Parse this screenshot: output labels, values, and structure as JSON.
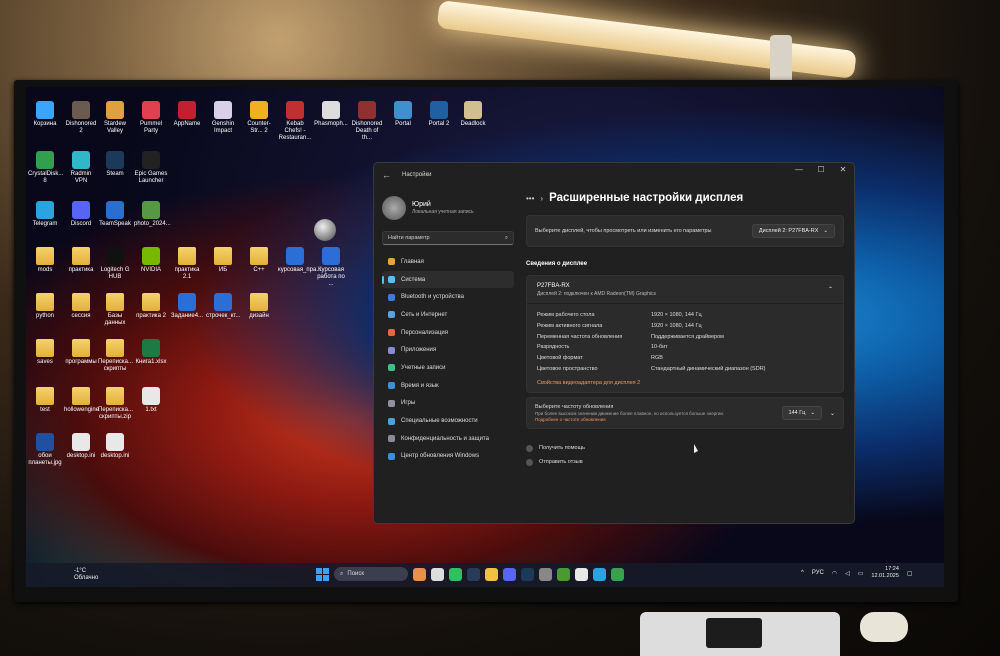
{
  "desktop_icons": [
    {
      "label": "Корзина",
      "x": 0,
      "color": "#3aa4ff"
    },
    {
      "label": "Dishonored 2",
      "color": "#6a5a50"
    },
    {
      "label": "Stardew Valley",
      "color": "#e0a040"
    },
    {
      "label": "Pummel Party",
      "color": "#e04050"
    },
    {
      "label": "AppName",
      "color": "#c02030"
    },
    {
      "label": "Genshin Impact",
      "color": "#d8d0e8"
    },
    {
      "label": "Counter-Str... 2",
      "color": "#f0b020"
    },
    {
      "label": "Kebab Chefs! - Restauran...",
      "color": "#c03030"
    },
    {
      "label": "Phasmoph...",
      "color": "#ddd"
    },
    {
      "label": "Dishonored Death of th...",
      "color": "#903030"
    },
    {
      "label": "Portal",
      "color": "#4090d0"
    },
    {
      "label": "Portal 2",
      "color": "#2060a0"
    },
    {
      "label": "Deadlock",
      "color": "#d0c090"
    },
    {
      "label": "CrystalDisk... 8",
      "color": "#30a050"
    },
    {
      "label": "Radmin VPN",
      "color": "#2fb8c8"
    },
    {
      "label": "Steam",
      "color": "#1b3a5a"
    },
    {
      "label": "Epic Games Launcher",
      "color": "#222"
    },
    {
      "label": "Telegram",
      "color": "#2aa3e0"
    },
    {
      "label": "Discord",
      "color": "#5865f2"
    },
    {
      "label": "TeamSpeak",
      "color": "#2a6fd0"
    },
    {
      "label": "photo_2024...",
      "color": "#559944"
    },
    {
      "label": "mods",
      "type": "folder"
    },
    {
      "label": "практика",
      "type": "folder"
    },
    {
      "label": "Logitech G HUB",
      "color": "#111"
    },
    {
      "label": "NVIDIA",
      "color": "#76b900"
    },
    {
      "label": "практика 2.1",
      "type": "folder"
    },
    {
      "label": "ИБ",
      "type": "folder"
    },
    {
      "label": "C++",
      "type": "folder"
    },
    {
      "label": "курсовая_пра...",
      "type": "doc"
    },
    {
      "label": "Курсовая работа по ...",
      "type": "doc"
    },
    {
      "label": "python",
      "type": "folder"
    },
    {
      "label": "сессия",
      "type": "folder"
    },
    {
      "label": "Базы данных",
      "type": "folder"
    },
    {
      "label": "практика 2",
      "type": "folder"
    },
    {
      "label": "Задание4...",
      "type": "doc"
    },
    {
      "label": "строчек_кт...",
      "type": "doc"
    },
    {
      "label": "дизайн",
      "type": "folder"
    },
    {
      "label": "saves",
      "type": "folder"
    },
    {
      "label": "программы",
      "type": "folder"
    },
    {
      "label": "Переписка... скрипты",
      "type": "folder"
    },
    {
      "label": "Книга1.xlsx",
      "color": "#1d7a44"
    },
    {
      "label": "test",
      "type": "folder"
    },
    {
      "label": "hollowengine",
      "type": "folder"
    },
    {
      "label": "Переписка... скрипты.zip",
      "type": "folder"
    },
    {
      "label": "1.txt",
      "type": "txt"
    },
    {
      "label": "обои планеты.jpg",
      "color": "#2050a0"
    },
    {
      "label": "desktop.ini",
      "type": "txt"
    },
    {
      "label": "desktop.ini",
      "type": "txt"
    }
  ],
  "window": {
    "title": "Настройки",
    "controls": [
      "—",
      "☐",
      "✕"
    ]
  },
  "profile": {
    "name": "Юрий",
    "subtitle": "Локальная учетная запись"
  },
  "search": {
    "placeholder": "Найти параметр",
    "icon": "search-icon"
  },
  "nav": [
    {
      "label": "Главная",
      "icon": "home-icon",
      "color": "#e8a33a"
    },
    {
      "label": "Система",
      "icon": "monitor-icon",
      "color": "#4cc2ff",
      "active": true
    },
    {
      "label": "Bluetooth и устройства",
      "icon": "bluetooth-icon",
      "color": "#3a7be0"
    },
    {
      "label": "Сеть и Интернет",
      "icon": "wifi-icon",
      "color": "#5aa0e0"
    },
    {
      "label": "Персонализация",
      "icon": "brush-icon",
      "color": "#e06a3a"
    },
    {
      "label": "Приложения",
      "icon": "apps-icon",
      "color": "#8a8ad0"
    },
    {
      "label": "Учетные записи",
      "icon": "person-icon",
      "color": "#3ac08a"
    },
    {
      "label": "Время и язык",
      "icon": "globe-icon",
      "color": "#3a90e0"
    },
    {
      "label": "Игры",
      "icon": "gamepad-icon",
      "color": "#9090a0"
    },
    {
      "label": "Специальные возможности",
      "icon": "accessibility-icon",
      "color": "#4aa0e0"
    },
    {
      "label": "Конфиденциальность и защита",
      "icon": "shield-icon",
      "color": "#8a8a9a"
    },
    {
      "label": "Центр обновления Windows",
      "icon": "update-icon",
      "color": "#3a90e0"
    }
  ],
  "main": {
    "breadcrumb_dots": "•••",
    "title": "Расширенные настройки дисплея",
    "select_label": "Выберите дисплей, чтобы просмотреть или изменить его параметры",
    "select_value": "Дисплей 2: P27FBA-RX",
    "section": "Сведения о дисплее",
    "display_name": "P27FBA-RX",
    "display_sub": "Дисплей 2: подключен к AMD Radeon(TM) Graphics",
    "rows": [
      {
        "k": "Режим рабочего стола",
        "v": "1920 × 1080, 144 Гц"
      },
      {
        "k": "Режим активного сигнала",
        "v": "1920 × 1080, 144 Гц"
      },
      {
        "k": "Переменная частота обновления",
        "v": "Поддерживается драйвером"
      },
      {
        "k": "Разрядность",
        "v": "10-бит"
      },
      {
        "k": "Цветовой формат",
        "v": "RGB"
      },
      {
        "k": "Цветовое пространство",
        "v": "Стандартный динамический диапазон (SDR)"
      }
    ],
    "adapter_link": "Свойства видеоадаптера для дисплея 2",
    "rate_title": "Выберите частоту обновления",
    "rate_desc": "При более высоком значении движение более плавное, но используется больше энергии.",
    "rate_link": "Подробнее о частоте обновления",
    "rate_value": "144 Гц",
    "help": "Получить помощь",
    "feedback": "Отправить отзыв"
  },
  "taskbar": {
    "weather_temp": "-1°C",
    "weather_desc": "Облачно",
    "search": "Поиск",
    "lang": "РУС",
    "time": "17:24",
    "date": "12.01.2025"
  }
}
